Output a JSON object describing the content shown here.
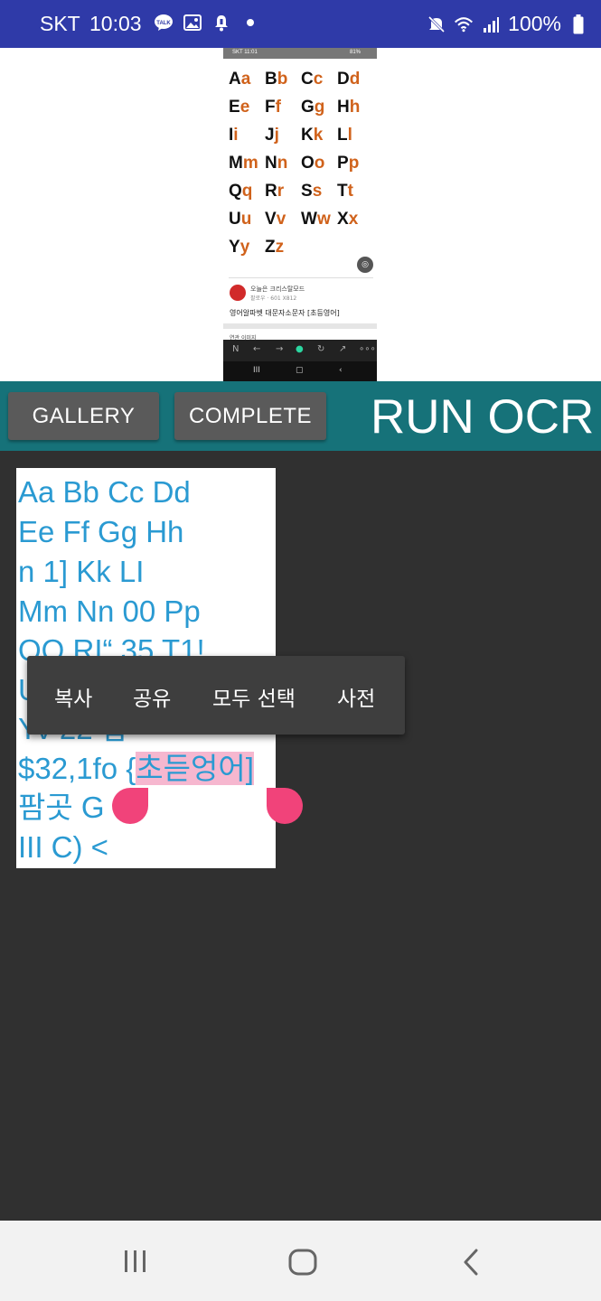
{
  "status_bar": {
    "carrier": "SKT",
    "time": "10:03",
    "battery": "100%",
    "icons_left": [
      "talk-icon",
      "image-icon",
      "notification-icon",
      "dot-icon"
    ],
    "icons_right": [
      "mute-icon",
      "wifi-icon",
      "signal-icon",
      "battery-icon"
    ]
  },
  "preview": {
    "thumb_status_carrier": "SKT 11:01",
    "thumb_status_right": "81%",
    "alphabet": [
      {
        "up": "A",
        "lo": "a"
      },
      {
        "up": "B",
        "lo": "b"
      },
      {
        "up": "C",
        "lo": "c"
      },
      {
        "up": "D",
        "lo": "d"
      },
      {
        "up": "E",
        "lo": "e"
      },
      {
        "up": "F",
        "lo": "f"
      },
      {
        "up": "G",
        "lo": "g"
      },
      {
        "up": "H",
        "lo": "h"
      },
      {
        "up": "I",
        "lo": "i"
      },
      {
        "up": "J",
        "lo": "j"
      },
      {
        "up": "K",
        "lo": "k"
      },
      {
        "up": "L",
        "lo": "l"
      },
      {
        "up": "M",
        "lo": "m"
      },
      {
        "up": "N",
        "lo": "n"
      },
      {
        "up": "O",
        "lo": "o"
      },
      {
        "up": "P",
        "lo": "p"
      },
      {
        "up": "Q",
        "lo": "q"
      },
      {
        "up": "R",
        "lo": "r"
      },
      {
        "up": "S",
        "lo": "s"
      },
      {
        "up": "T",
        "lo": "t"
      },
      {
        "up": "U",
        "lo": "u"
      },
      {
        "up": "V",
        "lo": "v"
      },
      {
        "up": "W",
        "lo": "w"
      },
      {
        "up": "X",
        "lo": "x"
      },
      {
        "up": "Y",
        "lo": "y"
      },
      {
        "up": "Z",
        "lo": "z"
      }
    ],
    "channel": "오늘은 크리스탈모드",
    "meta": "팔로우 · 601 X812",
    "caption": "영어알파벳 대문자소문자 [초등영어]",
    "more_label": "연관 이미지"
  },
  "toolbar": {
    "gallery_label": "GALLERY",
    "complete_label": "COMPLETE",
    "title": "RUN OCR"
  },
  "ocr_result": {
    "lines": [
      "Aa Bb Cc Dd",
      "Ee Ff Gg Hh",
      "n 1] Kk LI",
      "Mm Nn 00 Pp",
      "OO RI“ 35 T1!",
      "U",
      "Yv 22 답",
      "$32,1fo {",
      "팜곳 G",
      "III C) <"
    ],
    "selected_text": "초듣엉어]"
  },
  "context_menu": {
    "copy": "복사",
    "share": "공유",
    "select_all": "모두 선택",
    "dictionary": "사전"
  },
  "nav_bar": {
    "recents": "recents-icon",
    "home": "home-icon",
    "back": "back-icon"
  },
  "colors": {
    "status_bar": "#2f3aa8",
    "toolbar": "#167279",
    "ocr_text": "#2a9ad2",
    "selection": "#f6b7cf",
    "handle": "#f1437a"
  }
}
